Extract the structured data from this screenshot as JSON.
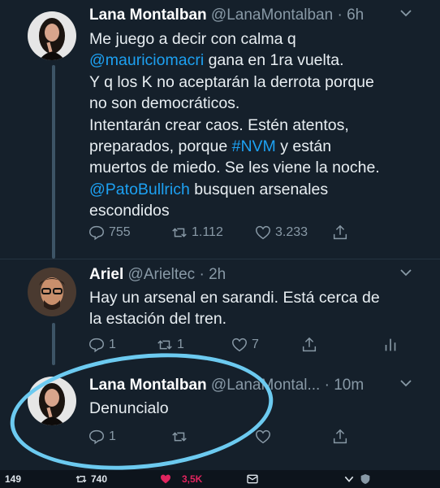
{
  "tweets": [
    {
      "name": "Lana Montalban",
      "handle": "@LanaMontalban",
      "time": "· 6h",
      "lines": [
        [
          {
            "t": "Me juego a decir con calma q"
          }
        ],
        [
          {
            "t": "@mauriciomacri",
            "link": true
          },
          {
            "t": " gana en 1ra vuelta."
          }
        ],
        [
          {
            "t": "Y q los K no aceptarán la derrota porque"
          }
        ],
        [
          {
            "t": "no son democráticos."
          }
        ],
        [
          {
            "t": "Intentarán crear caos. Estén atentos,"
          }
        ],
        [
          {
            "t": "preparados, porque "
          },
          {
            "t": "#NVM",
            "link": true
          },
          {
            "t": " y están"
          }
        ],
        [
          {
            "t": "muertos de miedo. Se les viene la noche."
          }
        ],
        [
          {
            "t": "@PatoBullrich",
            "link": true
          },
          {
            "t": " busquen arsenales"
          }
        ],
        [
          {
            "t": "escondidos"
          }
        ]
      ],
      "replies": "755",
      "retweets": "1.112",
      "likes": "3.233"
    },
    {
      "name": "Ariel",
      "handle": "@Arieltec",
      "time": "· 2h",
      "lines": [
        [
          {
            "t": "Hay un arsenal en sarandi. Está cerca de"
          }
        ],
        [
          {
            "t": "la estación del tren."
          }
        ]
      ],
      "replies": "1",
      "retweets": "1",
      "likes": "7"
    },
    {
      "name": "Lana Montalban",
      "handle": "@LanaMontal...",
      "time": "· 10m",
      "lines": [
        [
          {
            "t": "Denuncialo"
          }
        ]
      ],
      "replies": "1",
      "retweets": "",
      "likes": ""
    }
  ],
  "bottom_bar": {
    "replies": "149",
    "retweets": "740",
    "likes": "3,5K"
  },
  "colors": {
    "background": "#15202b",
    "link": "#1da1f2",
    "muted": "#8899a6",
    "highlight_circle": "#6ccaf0",
    "like_heart": "#e0245e"
  }
}
